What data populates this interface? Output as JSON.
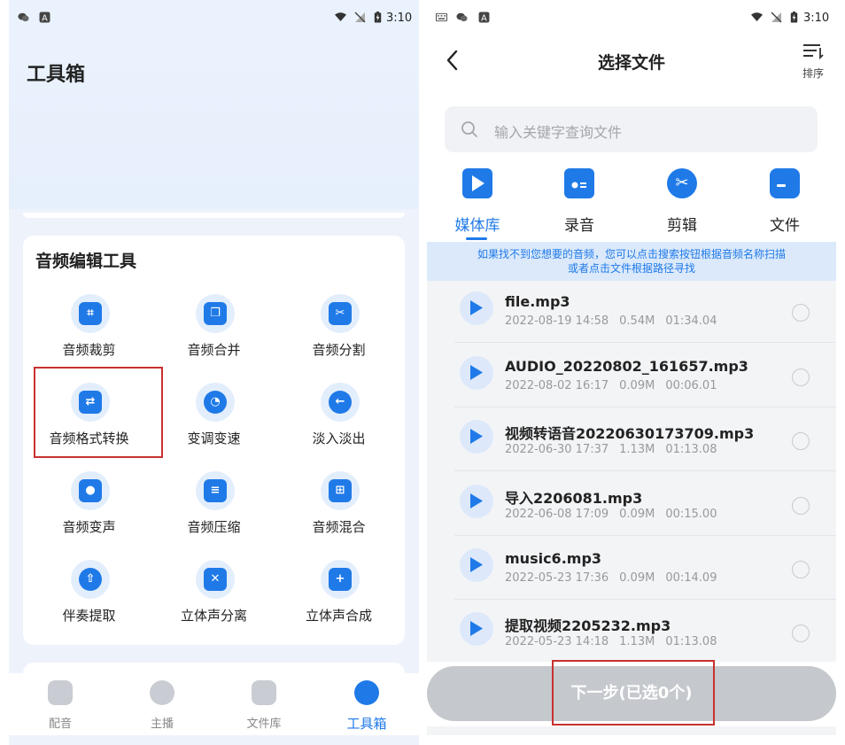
{
  "status_left": {
    "time": "3:10"
  },
  "status_right": {
    "time": "3:10"
  },
  "toolbox": {
    "title": "工具箱",
    "section_title": "音频编辑工具",
    "tools": [
      {
        "label": "音频裁剪",
        "icon": "crop-icon"
      },
      {
        "label": "音频合并",
        "icon": "merge-icon"
      },
      {
        "label": "音频分割",
        "icon": "split-icon"
      },
      {
        "label": "音频格式转换",
        "icon": "format-convert-icon"
      },
      {
        "label": "变调变速",
        "icon": "dial-icon"
      },
      {
        "label": "淡入淡出",
        "icon": "fade-icon"
      },
      {
        "label": "音频变声",
        "icon": "microphone-icon"
      },
      {
        "label": "音频压缩",
        "icon": "compress-icon"
      },
      {
        "label": "音频混合",
        "icon": "mix-icon"
      },
      {
        "label": "伴奏提取",
        "icon": "extract-icon"
      },
      {
        "label": "立体声分离",
        "icon": "stereo-split-icon"
      },
      {
        "label": "立体声合成",
        "icon": "stereo-merge-icon"
      }
    ],
    "tabs": [
      {
        "label": "配音",
        "icon": "dubbing-icon"
      },
      {
        "label": "主播",
        "icon": "anchor-icon"
      },
      {
        "label": "文件库",
        "icon": "file-library-icon"
      },
      {
        "label": "工具箱",
        "icon": "toolbox-icon"
      }
    ],
    "active_tab": "工具箱",
    "highlighted_tool": "音频格式转换"
  },
  "picker": {
    "title": "选择文件",
    "sort_label": "排序",
    "search_placeholder": "输入关键字查询文件",
    "categories": [
      {
        "label": "媒体库",
        "icon": "play-icon"
      },
      {
        "label": "录音",
        "icon": "radio-icon"
      },
      {
        "label": "剪辑",
        "icon": "scissors-icon"
      },
      {
        "label": "文件",
        "icon": "folder-icon"
      }
    ],
    "active_category": "媒体库",
    "notice_line1": "如果找不到您想要的音频，您可以点击搜索按钮根据音频名称扫描",
    "notice_line2": "或者点击文件根据路径寻找",
    "files": [
      {
        "name": "file.mp3",
        "date": "2022-08-19 14:58",
        "size": "0.54M",
        "duration": "01:34.04"
      },
      {
        "name": "AUDIO_20220802_161657.mp3",
        "date": "2022-08-02 16:17",
        "size": "0.09M",
        "duration": "00:06.01"
      },
      {
        "name": "视频转语音20220630173709.mp3",
        "date": "2022-06-30 17:37",
        "size": "1.13M",
        "duration": "01:13.08"
      },
      {
        "name": "导入2206081.mp3",
        "date": "2022-06-08 17:09",
        "size": "0.09M",
        "duration": "00:15.00"
      },
      {
        "name": "music6.mp3",
        "date": "2022-05-23 17:36",
        "size": "0.09M",
        "duration": "00:14.09"
      },
      {
        "name": "提取视频2205232.mp3",
        "date": "2022-05-23 14:18",
        "size": "1.13M",
        "duration": "01:13.08"
      }
    ],
    "next_button": "下一步(已选0个)"
  },
  "colors": {
    "accent": "#1f7ae8",
    "highlight_box": "#c8312f",
    "disabled_button": "#c5c8cd"
  }
}
